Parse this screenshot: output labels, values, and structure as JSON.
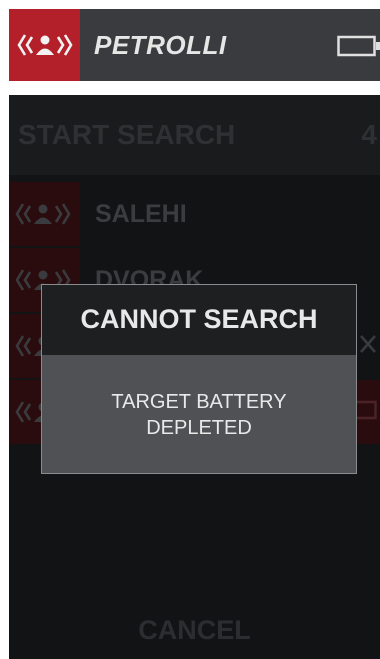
{
  "header": {
    "title": "PETROLLI",
    "icon": "person-signal-icon",
    "battery_icon": "battery-empty-icon"
  },
  "search": {
    "label": "START SEARCH",
    "count": "4"
  },
  "list": {
    "items": [
      {
        "name": "SALEHI"
      },
      {
        "name": "DVORAK"
      },
      {
        "name": ""
      },
      {
        "name": ""
      }
    ]
  },
  "cancel_label": "CANCEL",
  "dialog": {
    "title": "CANNOT SEARCH",
    "message": "TARGET BATTERY DEPLETED"
  },
  "colors": {
    "accent": "#b3202a",
    "header_bg": "#3a3b3e",
    "panel_bg": "#121314",
    "dialog_bg": "#505154"
  }
}
